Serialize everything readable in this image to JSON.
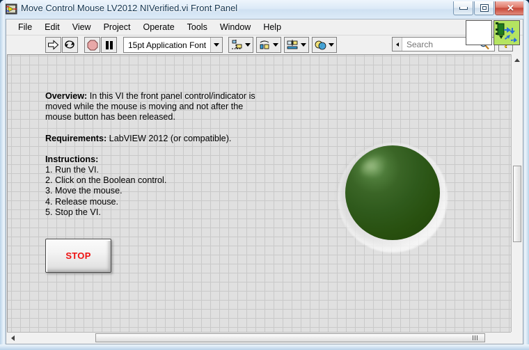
{
  "window": {
    "title": "Move Control Mouse LV2012 NIVerified.vi Front Panel",
    "icon_name": "labview-vi-icon",
    "controls": {
      "minimize_label": "Minimize",
      "restore_label": "Restore",
      "close_label": "✕"
    }
  },
  "menubar": {
    "items": [
      {
        "label": "File"
      },
      {
        "label": "Edit"
      },
      {
        "label": "View"
      },
      {
        "label": "Project"
      },
      {
        "label": "Operate"
      },
      {
        "label": "Tools"
      },
      {
        "label": "Window"
      },
      {
        "label": "Help"
      }
    ]
  },
  "toolbar": {
    "run_label": "Run",
    "run_continuous_label": "Run Continuously",
    "abort_label": "Abort Execution",
    "pause_label": "Pause",
    "font_selector": {
      "value": "15pt Application Font"
    },
    "align_label": "Align Objects",
    "distribute_label": "Distribute Objects",
    "resize_label": "Resize Objects",
    "reorder_label": "Reorder",
    "search": {
      "placeholder": "Search",
      "value": ""
    },
    "help_label": "?",
    "vi_icon_label": "VI Icon",
    "connector_pane_label": "Connector Pane"
  },
  "panel": {
    "overview": {
      "heading": "Overview:",
      "body": " In this VI the front panel control/indicator is moved while the mouse is moving and not after the mouse button has been released."
    },
    "requirements": {
      "heading": "Requirements:",
      "body": " LabVIEW 2012 (or compatible)."
    },
    "instructions": {
      "heading": "Instructions:",
      "steps": [
        "1. Run the VI.",
        "2. Click on the Boolean control.",
        "3. Move the mouse.",
        "4. Release mouse.",
        "5. Stop the VI."
      ]
    },
    "stop_button": {
      "label": "STOP"
    },
    "led": {
      "name": "round-led-indicator",
      "state": "off",
      "color_off": "#2d5a18",
      "color_highlight": "#6f9b5c"
    }
  },
  "scrollbars": {
    "vertical_label": "Vertical Scrollbar",
    "horizontal_label": "Horizontal Scrollbar"
  }
}
